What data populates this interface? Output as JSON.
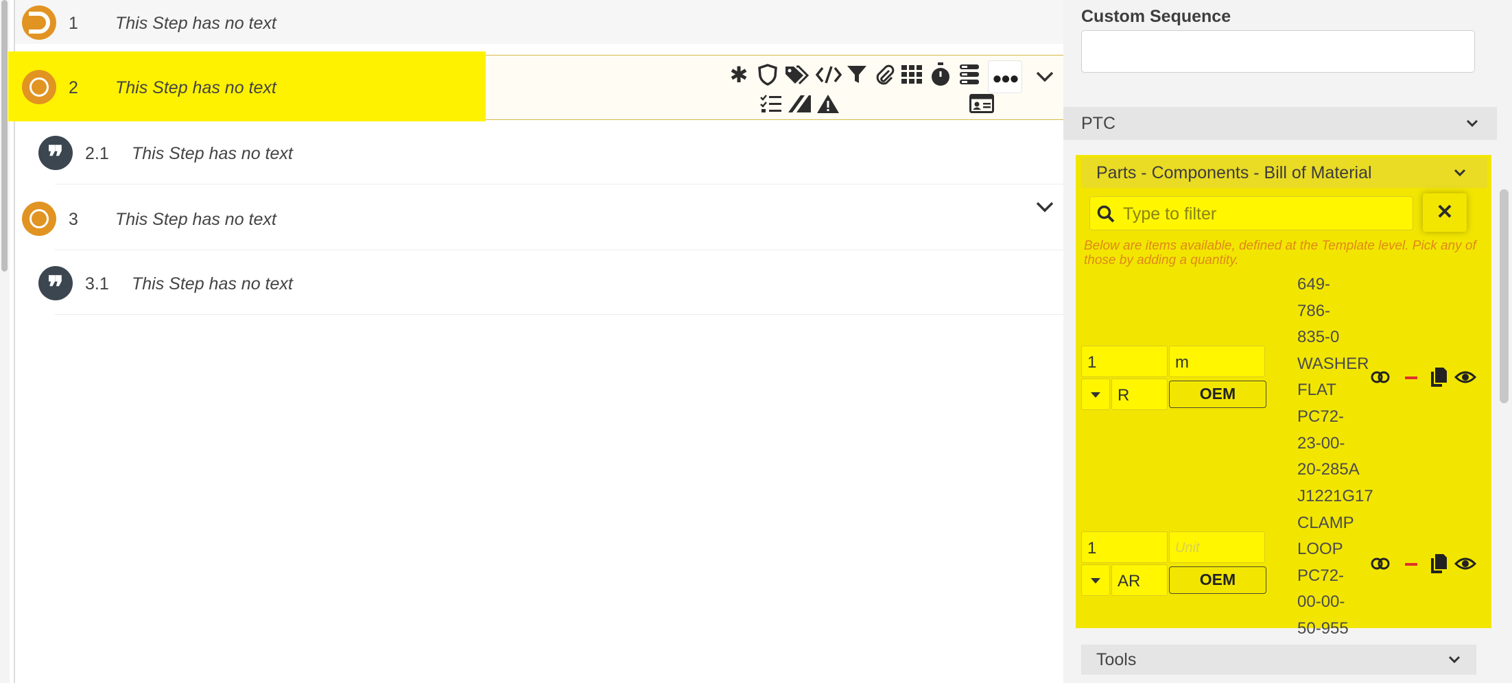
{
  "steps": [
    {
      "number": "1",
      "text": "This Step has no text",
      "icon": "step-icon-orange-partial"
    },
    {
      "number": "2",
      "text": "This Step has no text",
      "icon": "step-icon-orange-ring"
    },
    {
      "number": "2.1",
      "text": "This Step has no text",
      "icon": "quote-icon"
    },
    {
      "number": "3",
      "text": "This Step has no text",
      "icon": "step-icon-orange-ring"
    },
    {
      "number": "3.1",
      "text": "This Step has no text",
      "icon": "quote-icon"
    }
  ],
  "toolbar": {
    "row1_icons": [
      "asterisk-icon",
      "shield-icon",
      "tags-icon",
      "code-icon",
      "filter-icon",
      "paperclip-icon",
      "grid-icon",
      "stopwatch-icon",
      "database-icon",
      "more-icon"
    ],
    "row2_icons": [
      "checklist-icon",
      "signature-icon",
      "warning-icon",
      "id-card-icon"
    ]
  },
  "right_panel": {
    "custom_sequence_label": "Custom Sequence",
    "custom_sequence_value": "",
    "ptc_label": "PTC",
    "parts": {
      "title": "Parts - Components - Bill of Material",
      "filter_placeholder": "Type to filter",
      "hint": "Below are items available, defined at the Template level. Pick any of those by adding a quantity.",
      "items": [
        {
          "quantity": "1",
          "unit": "m",
          "unit_placeholder": "Unit",
          "type": "R",
          "oem_label": "OEM",
          "description_lines": [
            "649-",
            "786-",
            "835-0",
            "WASHER",
            "FLAT",
            "PC72-",
            "23-00-",
            "20-285A"
          ]
        },
        {
          "quantity": "1",
          "unit": "",
          "unit_placeholder": "Unit",
          "type": "AR",
          "oem_label": "OEM",
          "description_lines": [
            "J1221G17",
            "CLAMP",
            "LOOP",
            "PC72-",
            "00-00-",
            "50-955"
          ]
        }
      ]
    },
    "tools_label": "Tools"
  },
  "colors": {
    "highlight": "#fff200",
    "panel_highlight": "#f2e600",
    "orange": "#e19422",
    "hint_text": "#e0891a",
    "remove_red": "#e0312b",
    "quote_dark": "#3b4650"
  }
}
